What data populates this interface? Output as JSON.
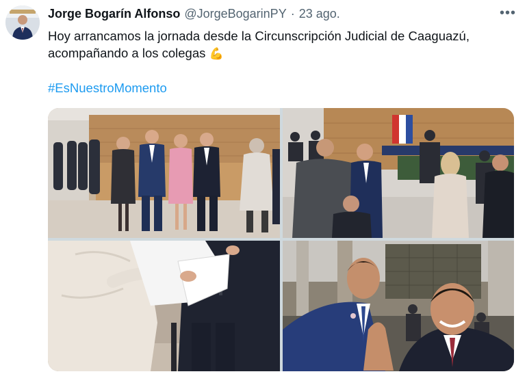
{
  "tweet": {
    "author_name": "Jorge Bogarín Alfonso",
    "handle": "@JorgeBogarinPY",
    "separator": "·",
    "date": "23 ago.",
    "more_label": "•••",
    "text_line1": "Hoy arrancamos la jornada desde la Circunscripción Judicial de Caaguazú,",
    "text_line2": "acompañando a los colegas",
    "emoji": "💪",
    "hashtag": "#EsNuestroMomento"
  },
  "media": {
    "photo_count": 4,
    "icons": {
      "avatar": "profile-photo",
      "more": "more-options-icon"
    }
  }
}
